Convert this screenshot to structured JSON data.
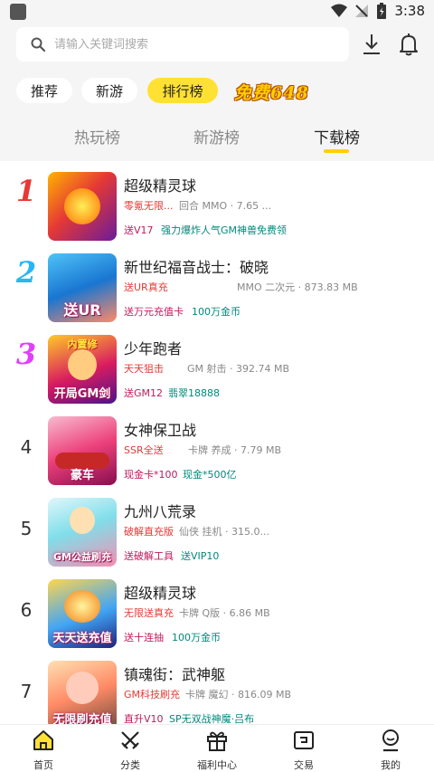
{
  "status_bar": {
    "time": "3:38"
  },
  "search": {
    "placeholder": "请输入关键词搜索"
  },
  "category_tabs": [
    {
      "label": "推荐",
      "active": false
    },
    {
      "label": "新游",
      "active": false
    },
    {
      "label": "排行榜",
      "active": true
    }
  ],
  "promo_banner": "免费648",
  "rank_tabs": [
    {
      "label": "热玩榜",
      "active": false
    },
    {
      "label": "新游榜",
      "active": false
    },
    {
      "label": "下载榜",
      "active": true
    }
  ],
  "games": [
    {
      "rank": "1",
      "name": "超级精灵球",
      "promo": "零氪无限...",
      "meta": "回合 MMO · 7.65 ...",
      "gift1": "送V17",
      "gift2": "强力爆炸人气GM神兽免费领",
      "thumb_caption": "",
      "thumb_top": "",
      "rank_color": "#e53935"
    },
    {
      "rank": "2",
      "name": "新世纪福音战士：破晓",
      "promo": "送UR真充",
      "meta": "MMO 二次元 · 873.83 MB",
      "gift1": "送万元充值卡",
      "gift2": "100万金币",
      "thumb_caption": "送UR",
      "thumb_top": "",
      "rank_color": "#29b6f6"
    },
    {
      "rank": "3",
      "name": "少年跑者",
      "promo": "天天狙击",
      "meta": "GM 射击 · 392.74 MB",
      "gift1": "送GM12",
      "gift2": "翡翠18888",
      "thumb_caption": "开局GM剑",
      "thumb_top": "内置修",
      "rank_color": "#e040fb"
    },
    {
      "rank": "4",
      "name": "女神保卫战",
      "promo": "SSR全送",
      "meta": "卡牌 养成 · 7.79 MB",
      "gift1": "现金卡*100",
      "gift2": "现金*500亿",
      "thumb_caption": "豪车",
      "thumb_top": "",
      "rank_color": "#333333"
    },
    {
      "rank": "5",
      "name": "九州八荒录",
      "promo": "破解直充版",
      "meta": "仙侠 挂机 · 315.0...",
      "gift1": "送破解工具",
      "gift2": "送VIP10",
      "thumb_caption": "GM公益刷充",
      "thumb_top": "",
      "rank_color": "#333333"
    },
    {
      "rank": "6",
      "name": "超级精灵球",
      "promo": "无限送真充",
      "meta": "卡牌 Q版 · 6.86 MB",
      "gift1": "送十连抽",
      "gift2": "100万金币",
      "thumb_caption": "天天送充值",
      "thumb_top": "",
      "rank_color": "#333333"
    },
    {
      "rank": "7",
      "name": "镇魂街：武神躯",
      "promo": "GM科技刷充",
      "meta": "卡牌 魔幻 · 816.09 MB",
      "gift1": "直升V10",
      "gift2": "SP无双战神魔·吕布",
      "thumb_caption": "无限刷充值",
      "thumb_top": "",
      "rank_color": "#333333"
    }
  ],
  "bottom_nav": [
    {
      "label": "首页",
      "icon": "home-icon",
      "active": true
    },
    {
      "label": "分类",
      "icon": "swords-icon",
      "active": false
    },
    {
      "label": "福利中心",
      "icon": "gift-icon",
      "active": false
    },
    {
      "label": "交易",
      "icon": "trade-icon",
      "active": false
    },
    {
      "label": "我的",
      "icon": "profile-icon",
      "active": false
    }
  ],
  "colors": {
    "accent_yellow": "#ffe133",
    "promo_red": "#e53935",
    "gift_pink": "#c2185b",
    "gift_teal": "#00897b"
  }
}
